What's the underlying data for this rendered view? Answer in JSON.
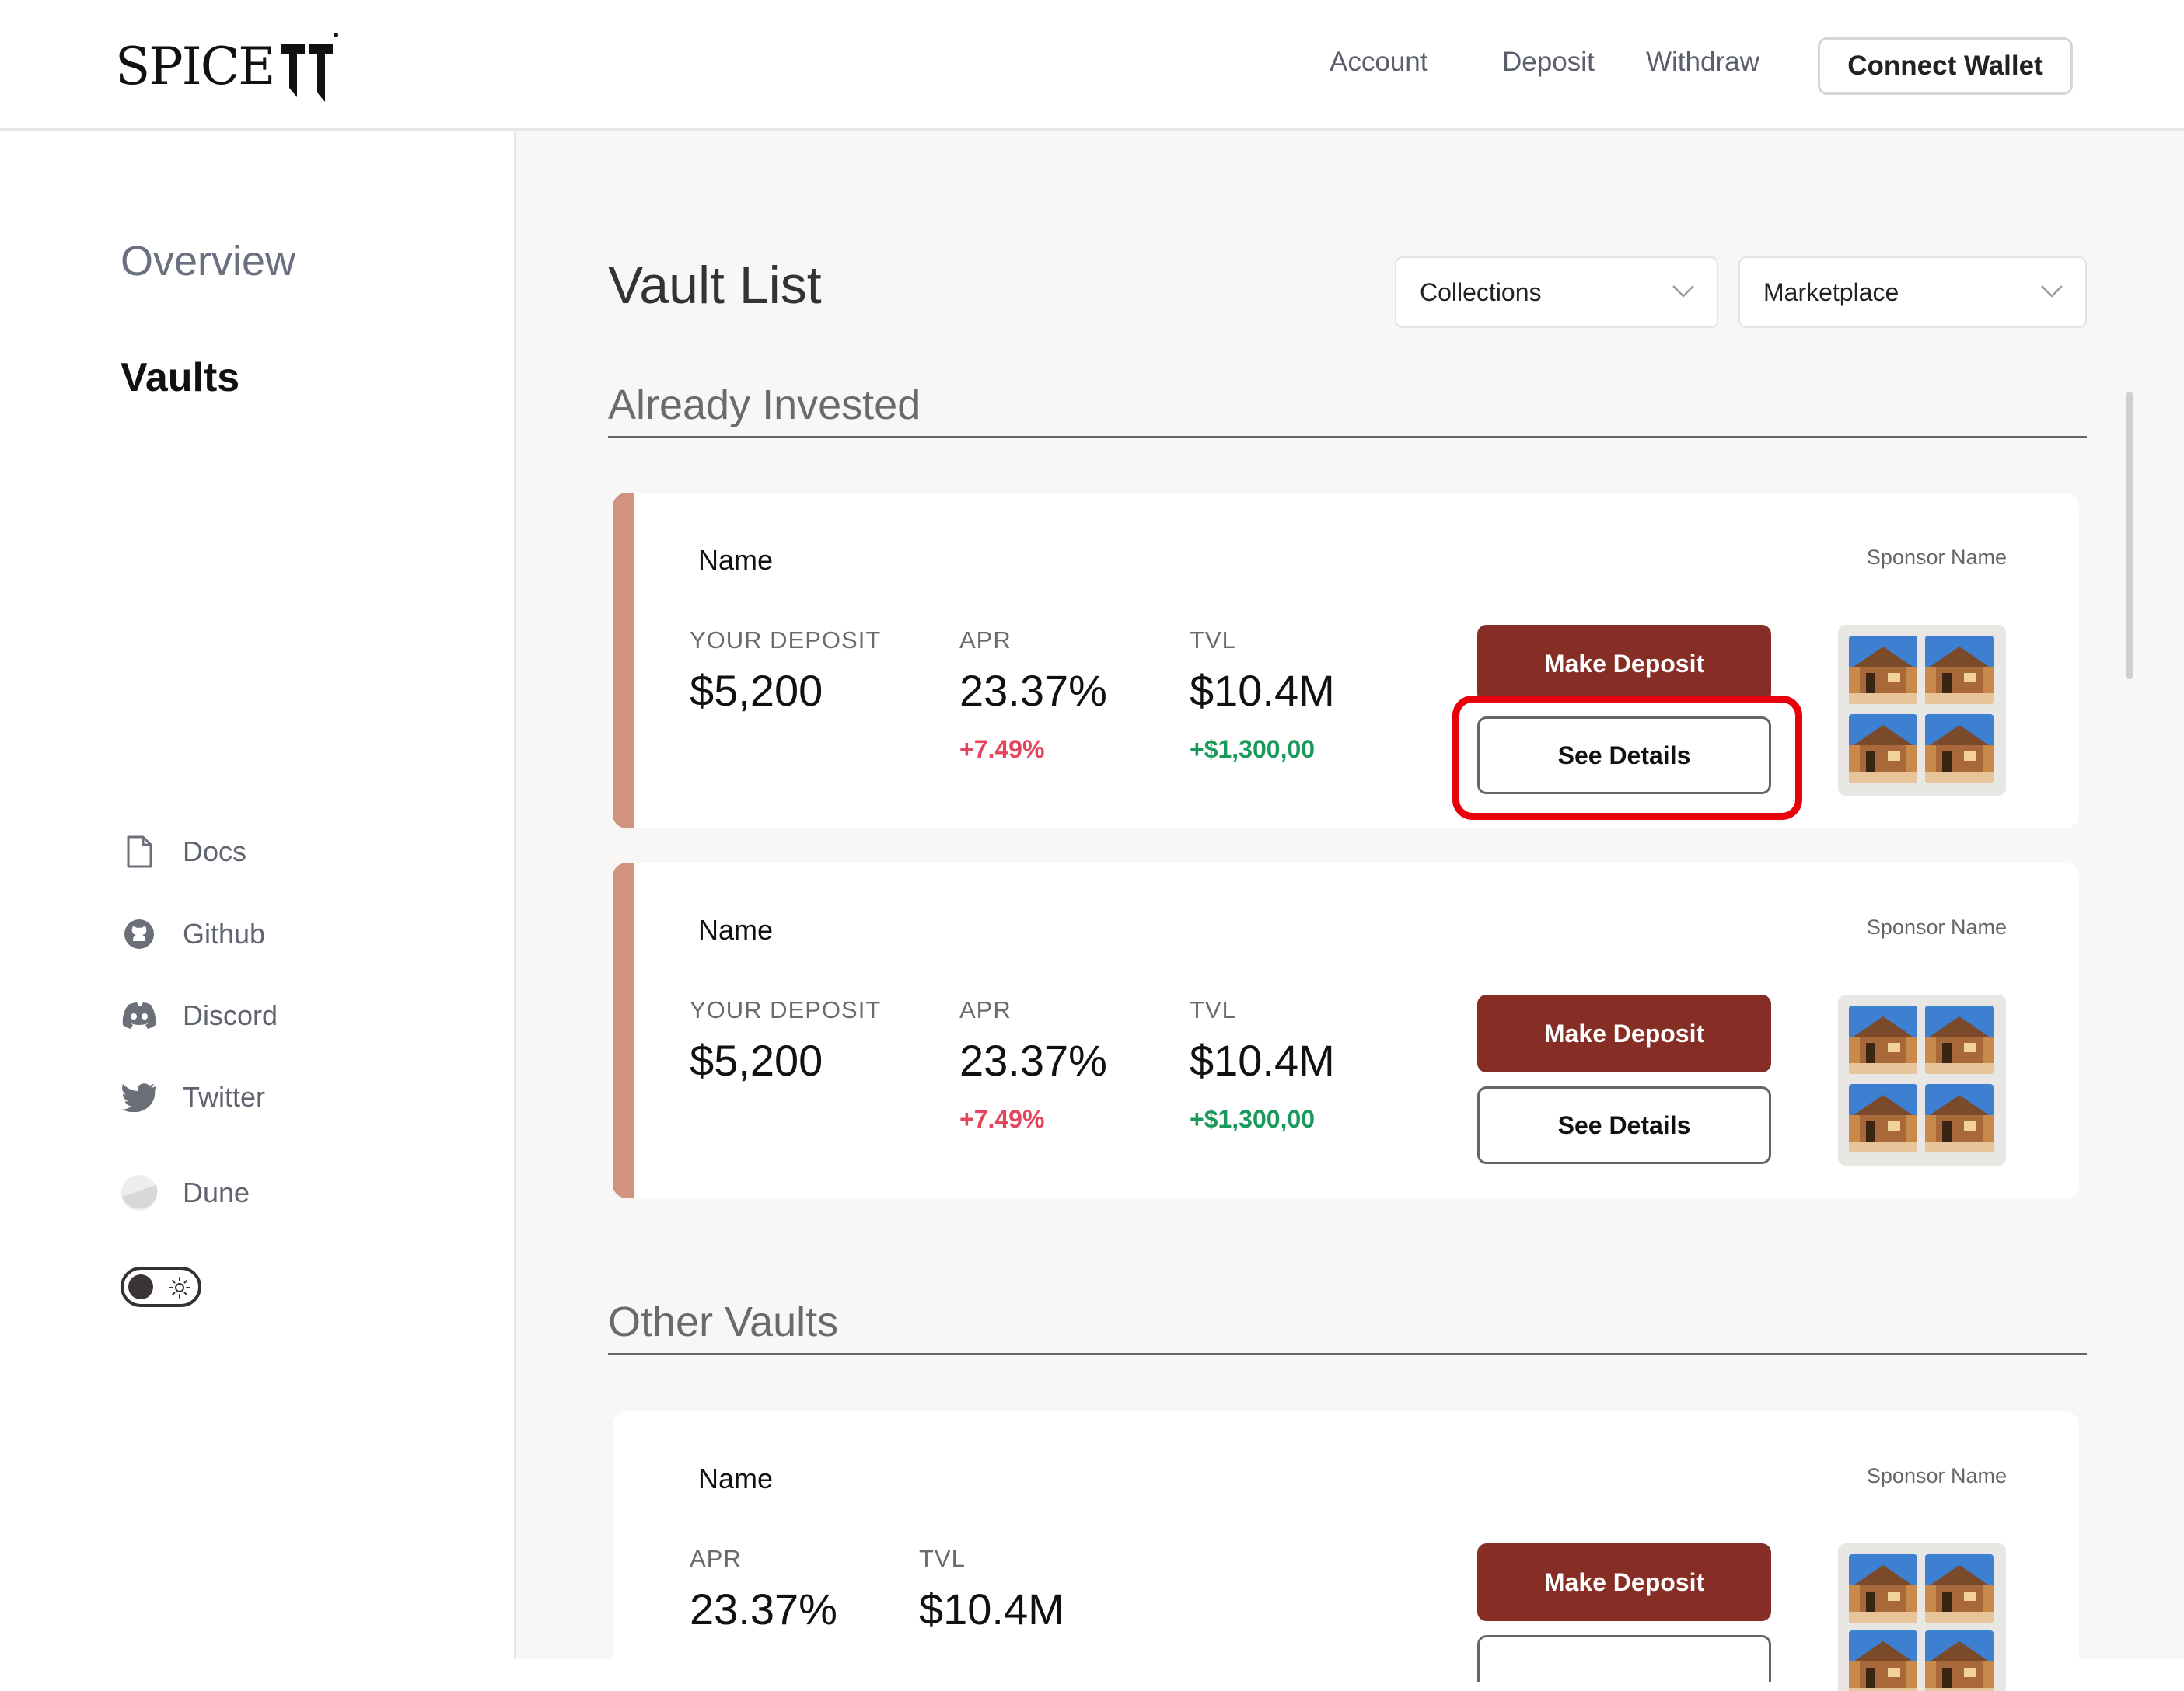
{
  "header": {
    "logo_text": "SPICE",
    "nav": [
      "Account",
      "Deposit",
      "Withdraw"
    ],
    "connect_label": "Connect Wallet"
  },
  "sidebar": {
    "overview": "Overview",
    "vaults": "Vaults",
    "links": [
      {
        "label": "Docs",
        "icon": "document-icon"
      },
      {
        "label": "Github",
        "icon": "github-icon"
      },
      {
        "label": "Discord",
        "icon": "discord-icon"
      },
      {
        "label": "Twitter",
        "icon": "twitter-icon"
      },
      {
        "label": "Dune",
        "icon": "dune-icon"
      }
    ],
    "theme_toggle": {
      "icon": "sun-icon"
    }
  },
  "main": {
    "title": "Vault List",
    "filters": [
      "Collections",
      "Marketplace"
    ],
    "sections": {
      "invested": "Already Invested",
      "other": "Other Vaults"
    },
    "invested_vaults": [
      {
        "name": "Name",
        "sponsor": "Sponsor Name",
        "deposit_label": "YOUR DEPOSIT",
        "deposit": "$5,200",
        "apr_label": "APR",
        "apr": "23.37%",
        "apr_change": "+7.49%",
        "tvl_label": "TVL",
        "tvl": "$10.4M",
        "tvl_change": "+$1,300,00",
        "primary_action": "Make Deposit",
        "secondary_action": "See Details"
      },
      {
        "name": "Name",
        "sponsor": "Sponsor Name",
        "deposit_label": "YOUR DEPOSIT",
        "deposit": "$5,200",
        "apr_label": "APR",
        "apr": "23.37%",
        "apr_change": "+7.49%",
        "tvl_label": "TVL",
        "tvl": "$10.4M",
        "tvl_change": "+$1,300,00",
        "primary_action": "Make Deposit",
        "secondary_action": "See Details"
      }
    ],
    "other_vaults": [
      {
        "name": "Name",
        "sponsor": "Sponsor Name",
        "apr_label": "APR",
        "apr": "23.37%",
        "tvl_label": "TVL",
        "tvl": "$10.4M",
        "primary_action": "Make Deposit"
      }
    ]
  },
  "colors": {
    "accent": "#cf9380",
    "primary_button": "#862e25",
    "positive": "#1a9a5a",
    "negative": "#e3455c",
    "highlight": "#e8000b"
  }
}
